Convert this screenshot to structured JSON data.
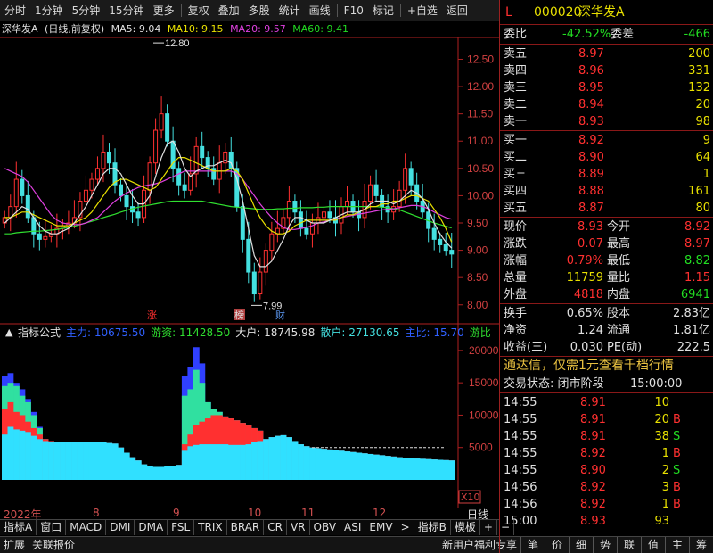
{
  "toolbar": {
    "items": [
      "分时",
      "1分钟",
      "5分钟",
      "15分钟",
      "更多",
      "复权",
      "叠加",
      "多股",
      "统计",
      "画线",
      "F10",
      "标记",
      "+自选",
      "返回"
    ]
  },
  "chart_header": {
    "stock_name": "深华发A",
    "mode": "(日线,前复权)",
    "ma5": "MA5: 9.04",
    "ma10": "MA10: 9.15",
    "ma20": "MA20: 9.57",
    "ma60": "MA60: 9.41"
  },
  "indicator_header": {
    "label": "指标公式",
    "zhuli": "主力: 10675.50",
    "youzi": "游资: 11428.50",
    "dahu": "大户: 18745.98",
    "sanhu": "散户: 27130.65",
    "zhubi": "主比: 15.70",
    "youbi": "游比"
  },
  "colors": {
    "ma5": "#e0e0e0",
    "ma10": "#e8e000",
    "ma20": "#e040e0",
    "ma60": "#30e030",
    "up": "#ff3030",
    "down": "#44e0e0",
    "axis": "#b02020"
  },
  "chart_data": [
    {
      "type": "candlestick",
      "title": "深华发A (日线,前复权)",
      "ylim": [
        7.8,
        12.9
      ],
      "yticks": [
        "12.50",
        "12.00",
        "11.50",
        "11.00",
        "10.50",
        "10.00",
        "9.50",
        "9.00",
        "8.50",
        "8.00"
      ],
      "ytick_values": [
        12.5,
        12.0,
        11.5,
        11.0,
        10.5,
        10.0,
        9.5,
        9.0,
        8.5,
        8.0
      ],
      "annotations": [
        {
          "text": "12.80",
          "value": 12.8
        },
        {
          "text": "7.99",
          "value": 7.99
        }
      ],
      "markers": [
        "涨",
        "榜",
        "财"
      ],
      "close": [
        9.6,
        9.8,
        10.3,
        10.0,
        9.6,
        9.3,
        9.2,
        9.25,
        9.3,
        9.4,
        9.45,
        9.5,
        9.6,
        9.9,
        10.1,
        10.3,
        10.5,
        10.8,
        10.6,
        10.2,
        10.0,
        9.8,
        9.7,
        9.6,
        10.1,
        10.6,
        11.2,
        11.5,
        11.0,
        10.5,
        10.2,
        10.1,
        10.4,
        10.9,
        10.7,
        10.5,
        10.3,
        10.6,
        10.8,
        10.5,
        9.8,
        9.2,
        8.6,
        8.2,
        8.6,
        9.0,
        9.3,
        9.4,
        9.6,
        9.9,
        9.7,
        9.4,
        9.3,
        9.5,
        9.6,
        9.7,
        9.6,
        9.5,
        9.8,
        9.9,
        9.7,
        9.6,
        9.9,
        10.2,
        10.0,
        9.8,
        9.7,
        9.8,
        10.1,
        10.5,
        10.2,
        9.9,
        9.7,
        9.4,
        9.2,
        9.1,
        9.0,
        8.93
      ],
      "ma5": [
        9.5,
        9.6,
        9.7,
        9.8,
        9.75,
        9.6,
        9.45,
        9.35,
        9.3,
        9.3,
        9.35,
        9.4,
        9.5,
        9.65,
        9.8,
        10.0,
        10.2,
        10.4,
        10.5,
        10.5,
        10.4,
        10.2,
        10.0,
        9.85,
        9.85,
        10.0,
        10.35,
        10.7,
        10.95,
        11.0,
        10.8,
        10.5,
        10.35,
        10.45,
        10.5,
        10.55,
        10.55,
        10.6,
        10.65,
        10.6,
        10.3,
        9.9,
        9.4,
        8.9,
        8.7,
        8.7,
        8.8,
        9.0,
        9.2,
        9.45,
        9.6,
        9.6,
        9.55,
        9.5,
        9.5,
        9.5,
        9.55,
        9.6,
        9.65,
        9.7,
        9.7,
        9.7,
        9.75,
        9.85,
        9.9,
        9.9,
        9.9,
        9.85,
        9.9,
        10.0,
        10.1,
        10.05,
        9.95,
        9.75,
        9.5,
        9.3,
        9.15,
        9.04
      ],
      "ma10": [
        9.6,
        9.6,
        9.65,
        9.7,
        9.7,
        9.65,
        9.6,
        9.55,
        9.5,
        9.45,
        9.45,
        9.45,
        9.5,
        9.55,
        9.6,
        9.7,
        9.85,
        10.0,
        10.15,
        10.25,
        10.3,
        10.3,
        10.25,
        10.2,
        10.15,
        10.1,
        10.15,
        10.3,
        10.45,
        10.6,
        10.7,
        10.7,
        10.65,
        10.6,
        10.55,
        10.5,
        10.45,
        10.45,
        10.45,
        10.5,
        10.45,
        10.3,
        10.05,
        9.8,
        9.6,
        9.45,
        9.35,
        9.3,
        9.3,
        9.35,
        9.45,
        9.5,
        9.55,
        9.55,
        9.55,
        9.55,
        9.55,
        9.55,
        9.6,
        9.65,
        9.65,
        9.7,
        9.75,
        9.8,
        9.8,
        9.85,
        9.85,
        9.9,
        9.9,
        9.95,
        10.0,
        10.0,
        9.95,
        9.9,
        9.75,
        9.6,
        9.4,
        9.15
      ],
      "ma20": [
        10.5,
        10.45,
        10.4,
        10.35,
        10.25,
        10.1,
        9.95,
        9.8,
        9.65,
        9.55,
        9.5,
        9.48,
        9.47,
        9.47,
        9.5,
        9.55,
        9.6,
        9.7,
        9.8,
        9.9,
        9.98,
        10.05,
        10.1,
        10.15,
        10.18,
        10.2,
        10.22,
        10.25,
        10.3,
        10.35,
        10.4,
        10.45,
        10.45,
        10.45,
        10.45,
        10.45,
        10.45,
        10.45,
        10.45,
        10.45,
        10.4,
        10.3,
        10.15,
        10.0,
        9.85,
        9.72,
        9.6,
        9.5,
        9.42,
        9.38,
        9.38,
        9.4,
        9.42,
        9.45,
        9.5,
        9.52,
        9.55,
        9.57,
        9.6,
        9.62,
        9.64,
        9.66,
        9.68,
        9.7,
        9.72,
        9.74,
        9.75,
        9.76,
        9.78,
        9.8,
        9.82,
        9.82,
        9.8,
        9.76,
        9.7,
        9.65,
        9.6,
        9.57
      ],
      "ma60": [
        9.3,
        9.3,
        9.32,
        9.33,
        9.34,
        9.35,
        9.35,
        9.36,
        9.37,
        9.38,
        9.4,
        9.42,
        9.44,
        9.47,
        9.5,
        9.53,
        9.56,
        9.6,
        9.63,
        9.66,
        9.7,
        9.73,
        9.76,
        9.79,
        9.81,
        9.83,
        9.85,
        9.87,
        9.89,
        9.9,
        9.9,
        9.9,
        9.9,
        9.9,
        9.9,
        9.88,
        9.86,
        9.84,
        9.82,
        9.8,
        9.79,
        9.78,
        9.77,
        9.76,
        9.75,
        9.75,
        9.75,
        9.76,
        9.76,
        9.77,
        9.77,
        9.78,
        9.78,
        9.78,
        9.79,
        9.79,
        9.8,
        9.8,
        9.8,
        9.8,
        9.8,
        9.8,
        9.8,
        9.8,
        9.8,
        9.79,
        9.78,
        9.76,
        9.74,
        9.7,
        9.66,
        9.62,
        9.58,
        9.54,
        9.5,
        9.47,
        9.44,
        9.41
      ]
    },
    {
      "type": "bar",
      "title": "指标公式",
      "ylim": [
        0,
        21500
      ],
      "yticks": [
        "20000",
        "15000",
        "10000",
        "5000"
      ],
      "ytick_values": [
        20000,
        15000,
        10000,
        5000
      ],
      "scale_label": "X10",
      "series": [
        {
          "name": "散户",
          "values": [
            7000,
            8200,
            7800,
            7600,
            7400,
            6800,
            6300,
            6000,
            5900,
            5800,
            5800,
            5800,
            5800,
            5800,
            5800,
            5800,
            5800,
            5800,
            5700,
            5600,
            5000,
            4200,
            3500,
            3000,
            2400,
            2100,
            2000,
            2000,
            2100,
            2200,
            2300,
            4500,
            5200,
            5400,
            5500,
            5500,
            5500,
            5500,
            5500,
            5400,
            5400,
            5400,
            5500,
            5800,
            6000,
            6300,
            6600,
            6800,
            6900,
            6600,
            6000,
            5500,
            5200,
            5000,
            4900,
            4800,
            4700,
            4600,
            4500,
            4400,
            4300,
            4200,
            4100,
            4000,
            3900,
            3800,
            3700,
            3600,
            3500,
            3400,
            3350,
            3300,
            3250,
            3200,
            3150,
            3100,
            3050,
            3000
          ]
        },
        {
          "name": "大户",
          "values": [
            11000,
            12000,
            10500,
            10000,
            9000,
            8000,
            7000,
            6300,
            6000,
            5900,
            5800,
            5800,
            5800,
            5800,
            5800,
            5800,
            5800,
            5800,
            5700,
            5600,
            5000,
            4200,
            3500,
            3000,
            2400,
            2100,
            2000,
            2000,
            2100,
            2200,
            2300,
            5500,
            7000,
            8500,
            9000,
            9500,
            10000,
            10000,
            9800,
            9500,
            9200,
            8800,
            8400,
            8000,
            7600,
            6300,
            6600,
            6800,
            6900,
            6600,
            6000,
            5500,
            5200,
            5000,
            4900,
            4800,
            4700,
            4600,
            4500,
            4400,
            4300,
            4200,
            4100,
            4000,
            3900,
            3800,
            3700,
            3600,
            3500,
            3400,
            3350,
            3300,
            3250,
            3200,
            3150,
            3100,
            3050,
            3000
          ]
        },
        {
          "name": "游资",
          "values": [
            14500,
            15000,
            14500,
            13000,
            12000,
            10000,
            8000,
            6300,
            6000,
            5900,
            5800,
            5800,
            5800,
            5800,
            5800,
            5800,
            5800,
            5800,
            5700,
            5600,
            5000,
            4200,
            3500,
            3000,
            2400,
            2100,
            2000,
            2000,
            2100,
            2200,
            2300,
            13000,
            14000,
            17000,
            15000,
            12000,
            11000,
            10500,
            9800,
            9500,
            9200,
            8800,
            8400,
            8000,
            7600,
            6300,
            6600,
            6800,
            6900,
            6600,
            6000,
            5500,
            5200,
            5000,
            4900,
            4800,
            4700,
            4600,
            4500,
            4400,
            4300,
            4200,
            4100,
            4000,
            3900,
            3800,
            3700,
            3600,
            3500,
            3400,
            3350,
            3300,
            3250,
            3200,
            3150,
            3100,
            3050,
            3000
          ]
        },
        {
          "name": "主力",
          "values": [
            16000,
            16500,
            15000,
            14000,
            12500,
            10500,
            8200,
            6300,
            6000,
            5900,
            5800,
            5800,
            5800,
            5800,
            5800,
            5800,
            5800,
            5800,
            5700,
            5600,
            5000,
            4200,
            3500,
            3000,
            2400,
            2100,
            2000,
            2000,
            2100,
            2200,
            2300,
            16000,
            17500,
            20500,
            18000,
            12000,
            11000,
            10500,
            9800,
            9500,
            9200,
            8800,
            8400,
            8000,
            7600,
            6300,
            6600,
            6800,
            6900,
            6600,
            6000,
            5500,
            5200,
            5000,
            4900,
            4800,
            4700,
            4600,
            4500,
            4400,
            4300,
            4200,
            4100,
            4000,
            3900,
            3800,
            3700,
            3600,
            3500,
            3400,
            3350,
            3300,
            3250,
            3200,
            3150,
            3100,
            3050,
            3000
          ]
        }
      ]
    }
  ],
  "time_axis": {
    "labels": [
      "2022年",
      "8",
      "9",
      "10",
      "11",
      "12"
    ],
    "period": "日线"
  },
  "bottom_tabs": [
    "指标A",
    "窗口",
    "MACD",
    "DMI",
    "DMA",
    "FSL",
    "TRIX",
    "BRAR",
    "CR",
    "VR",
    "OBV",
    "ASI",
    "EMV",
    ">",
    "指标B",
    "模板",
    "+",
    "−"
  ],
  "status_left": [
    "扩展",
    "关联报价"
  ],
  "status_promo": "新用户福利专享",
  "status_right": [
    "笔",
    "价",
    "细",
    "势",
    "联",
    "值",
    "主",
    "筹"
  ],
  "quote": {
    "marker": "L",
    "code": "000020",
    "name": "深华发A",
    "weibi_label": "委比",
    "weibi": "-42.52%",
    "weicha_label": "委差",
    "weicha": "-466",
    "asks": [
      {
        "label": "卖五",
        "price": "8.97",
        "vol": "200"
      },
      {
        "label": "卖四",
        "price": "8.96",
        "vol": "331"
      },
      {
        "label": "卖三",
        "price": "8.95",
        "vol": "132"
      },
      {
        "label": "卖二",
        "price": "8.94",
        "vol": "20"
      },
      {
        "label": "卖一",
        "price": "8.93",
        "vol": "98"
      }
    ],
    "bids": [
      {
        "label": "买一",
        "price": "8.92",
        "vol": "9"
      },
      {
        "label": "买二",
        "price": "8.90",
        "vol": "64"
      },
      {
        "label": "买三",
        "price": "8.89",
        "vol": "1"
      },
      {
        "label": "买四",
        "price": "8.88",
        "vol": "161"
      },
      {
        "label": "买五",
        "price": "8.87",
        "vol": "80"
      }
    ],
    "stats": [
      {
        "l1": "现价",
        "v1": "8.93",
        "c1": "red",
        "l2": "今开",
        "v2": "8.92",
        "c2": "red"
      },
      {
        "l1": "涨跌",
        "v1": "0.07",
        "c1": "red",
        "l2": "最高",
        "v2": "8.97",
        "c2": "red"
      },
      {
        "l1": "涨幅",
        "v1": "0.79%",
        "c1": "red",
        "l2": "最低",
        "v2": "8.82",
        "c2": "green"
      },
      {
        "l1": "总量",
        "v1": "11759",
        "c1": "yellow",
        "l2": "量比",
        "v2": "1.15",
        "c2": "red"
      },
      {
        "l1": "外盘",
        "v1": "4818",
        "c1": "red",
        "l2": "内盘",
        "v2": "6941",
        "c2": "green"
      }
    ],
    "stats2": [
      {
        "l1": "换手",
        "v1": "0.65%",
        "l2": "股本",
        "v2": "2.83亿"
      },
      {
        "l1": "净资",
        "v1": "1.24",
        "l2": "流通",
        "v2": "1.81亿"
      },
      {
        "l1": "收益(三)",
        "v1": "0.030",
        "l2": "PE(动)",
        "v2": "222.5"
      }
    ],
    "promo": "通达信，仅需1元查看千档行情",
    "trade_status_label": "交易状态: 闭市阶段",
    "trade_status_time": "15:00:00",
    "ticks": [
      {
        "time": "14:55",
        "price": "8.91",
        "vol": "10",
        "side": "",
        "pc": "red",
        "vc": "yellow"
      },
      {
        "time": "14:55",
        "price": "8.91",
        "vol": "20",
        "side": "B",
        "pc": "red",
        "vc": "yellow"
      },
      {
        "time": "14:55",
        "price": "8.91",
        "vol": "38",
        "side": "S",
        "pc": "red",
        "vc": "yellow"
      },
      {
        "time": "14:55",
        "price": "8.92",
        "vol": "1",
        "side": "B",
        "pc": "red",
        "vc": "yellow"
      },
      {
        "time": "14:55",
        "price": "8.90",
        "vol": "2",
        "side": "S",
        "pc": "red",
        "vc": "yellow"
      },
      {
        "time": "14:56",
        "price": "8.92",
        "vol": "3",
        "side": "B",
        "pc": "red",
        "vc": "yellow"
      },
      {
        "time": "14:56",
        "price": "8.92",
        "vol": "1",
        "side": "B",
        "pc": "red",
        "vc": "yellow"
      },
      {
        "time": "15:00",
        "price": "8.93",
        "vol": "93",
        "side": "",
        "pc": "red",
        "vc": "yellow"
      }
    ]
  }
}
